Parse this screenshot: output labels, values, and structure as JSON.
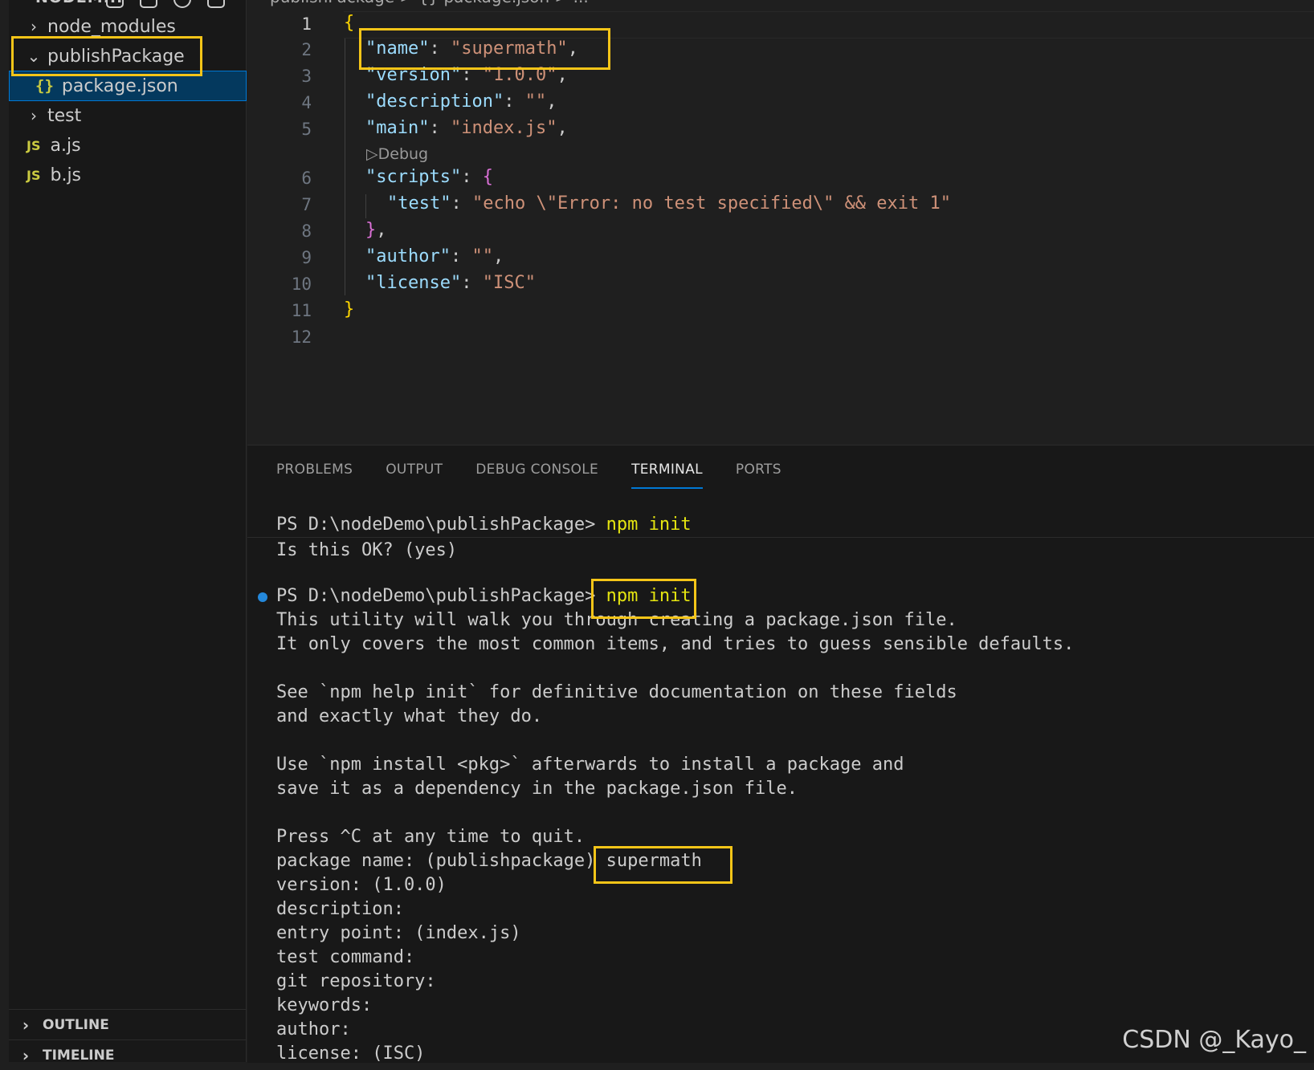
{
  "sidebar": {
    "header": "NODEM...",
    "tree": [
      {
        "label": "node_modules",
        "type": "folder",
        "expanded": false
      },
      {
        "label": "publishPackage",
        "type": "folder",
        "expanded": true
      },
      {
        "label": "package.json",
        "type": "json",
        "selected": true,
        "icon": "{}"
      },
      {
        "label": "test",
        "type": "folder",
        "expanded": false
      },
      {
        "label": "a.js",
        "type": "js",
        "icon": "JS"
      },
      {
        "label": "b.js",
        "type": "js",
        "icon": "JS"
      }
    ],
    "sections": [
      {
        "label": "OUTLINE"
      },
      {
        "label": "TIMELINE"
      }
    ]
  },
  "editor": {
    "breadcrumb": "publishPackage > {} package.json > ...",
    "line_numbers": [
      "1",
      "2",
      "3",
      "4",
      "5",
      "6",
      "7",
      "8",
      "9",
      "10",
      "11",
      "12"
    ],
    "lines": {
      "l1": "{",
      "l2_key": "\"name\"",
      "l2_val": "\"supermath\"",
      "l3_key": "\"version\"",
      "l3_val": "\"1.0.0\"",
      "l4_key": "\"description\"",
      "l4_val": "\"\"",
      "l5_key": "\"main\"",
      "l5_val": "\"index.js\"",
      "codelens": "Debug",
      "l6_key": "\"scripts\"",
      "l6_brace": "{",
      "l7_key": "\"test\"",
      "l7_val": "\"echo \\\"Error: no test specified\\\" && exit 1\"",
      "l8": "}",
      "l9_key": "\"author\"",
      "l9_val": "\"\"",
      "l10_key": "\"license\"",
      "l10_val": "\"ISC\"",
      "l11": "}"
    }
  },
  "panel": {
    "tabs": [
      "PROBLEMS",
      "OUTPUT",
      "DEBUG CONSOLE",
      "TERMINAL",
      "PORTS"
    ],
    "active_tab": "TERMINAL",
    "prompt": "PS D:\\nodeDemo\\publishPackage>",
    "cmd": "npm init",
    "ok_line": "Is this OK? (yes)",
    "out1": "This utility will walk you through creating a package.json file.",
    "out2": "It only covers the most common items, and tries to guess sensible defaults.",
    "out3": "See `npm help init` for definitive documentation on these fields",
    "out4": "and exactly what they do.",
    "out5": "Use `npm install <pkg>` afterwards to install a package and",
    "out6": "save it as a dependency in the package.json file.",
    "out7": "Press ^C at any time to quit.",
    "q_name": "package name: (publishpackage)",
    "a_name": "supermath",
    "q_version": "version: (1.0.0)",
    "q_desc": "description:",
    "q_entry": "entry point: (index.js)",
    "q_test": "test command:",
    "q_git": "git repository:",
    "q_keywords": "keywords:",
    "q_author": "author:",
    "q_license": "license: (ISC)"
  },
  "watermark": "CSDN @_Kayo_",
  "colors": {
    "highlight": "#f5c518",
    "selection": "#04395e",
    "accent": "#0078d4"
  }
}
